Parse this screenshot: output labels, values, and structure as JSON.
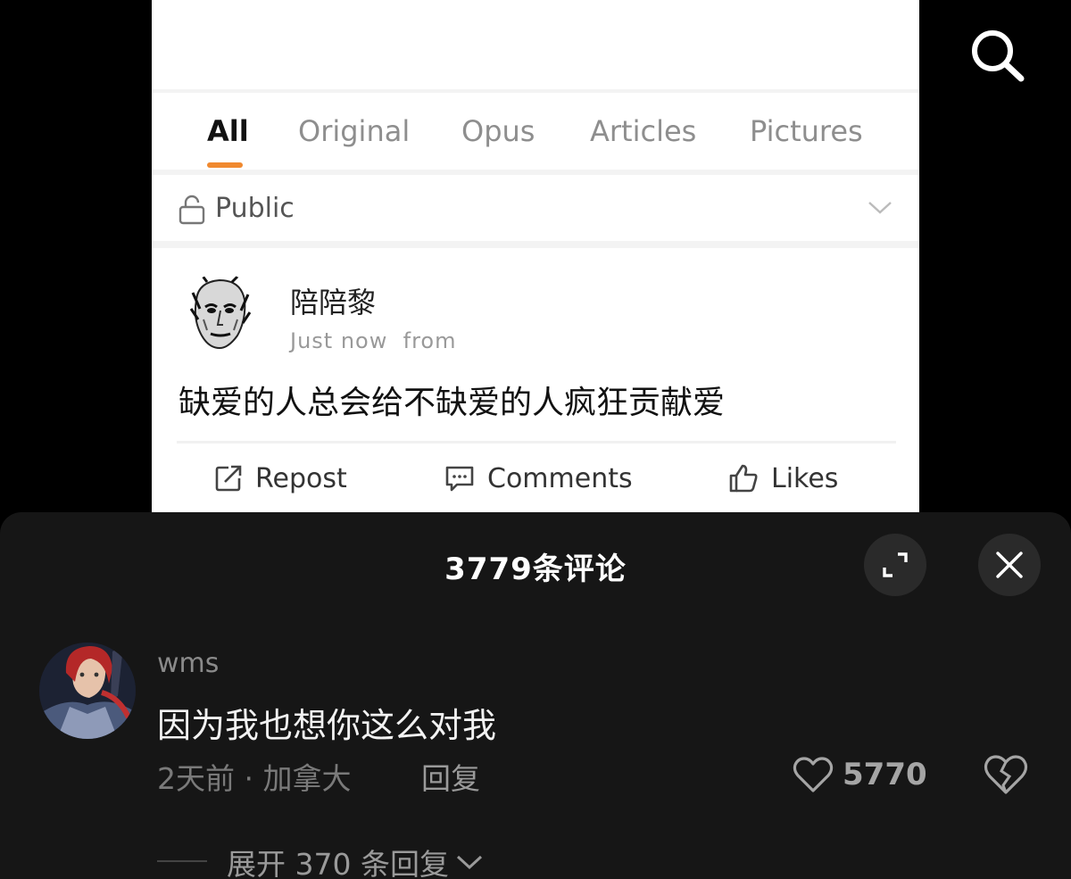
{
  "tabs": [
    {
      "label": "All",
      "active": true
    },
    {
      "label": "Original",
      "active": false
    },
    {
      "label": "Opus",
      "active": false
    },
    {
      "label": "Articles",
      "active": false
    },
    {
      "label": "Pictures",
      "active": false
    }
  ],
  "visibility": {
    "label": "Public"
  },
  "post": {
    "author": "陪陪黎",
    "time": "Just now",
    "from": "from",
    "text": "缺爱的人总会给不缺爱的人疯狂贡献爱"
  },
  "actions": {
    "repost": "Repost",
    "comments": "Comments",
    "likes": "Likes"
  },
  "comments_sheet": {
    "title": "3779条评论",
    "comment": {
      "username": "wms",
      "text": "因为我也想你这么对我",
      "meta": "2天前 · 加拿大",
      "reply": "回复",
      "likes": "5770"
    },
    "expand_replies": "展开 370 条回复"
  },
  "colors": {
    "accent": "#f0892f",
    "sheet_bg": "#161616",
    "card_bg": "#ffffff"
  }
}
